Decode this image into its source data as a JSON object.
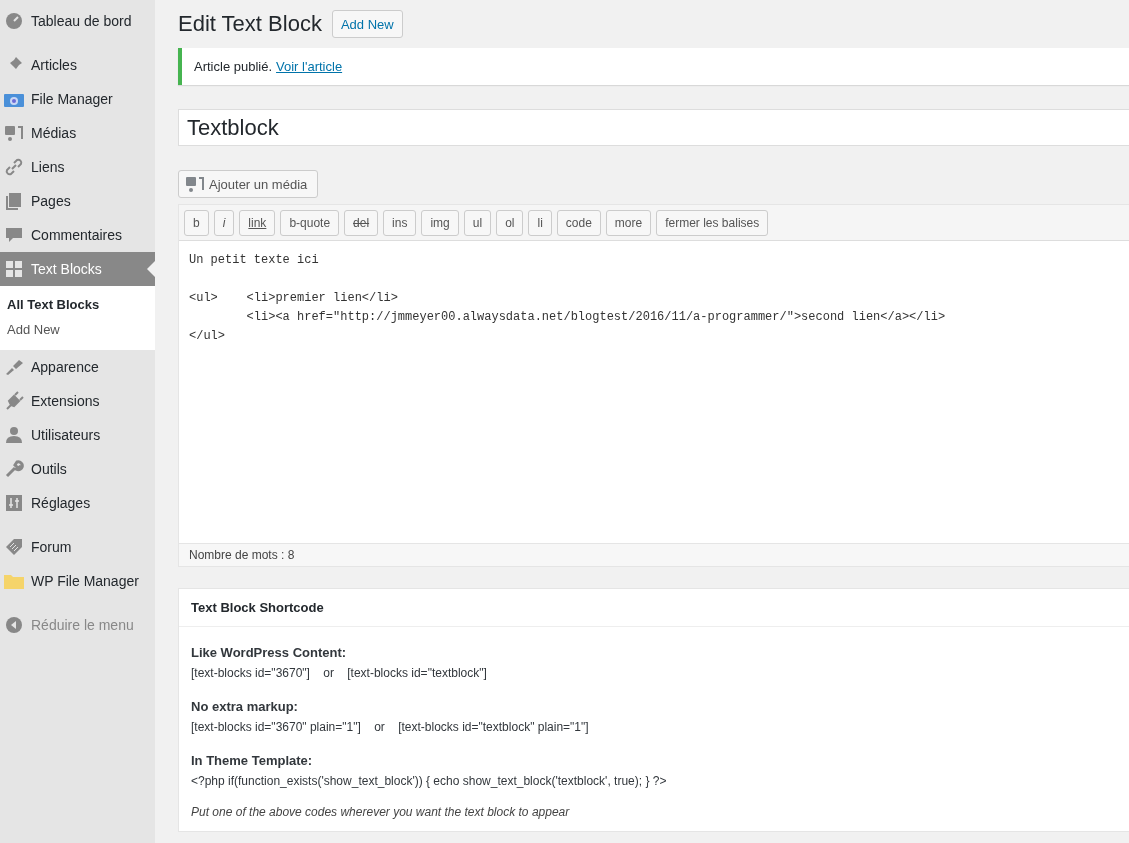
{
  "sidebar": {
    "groups": [
      [
        {
          "label": "Tableau de bord",
          "selected": false
        }
      ],
      [
        {
          "label": "Articles",
          "selected": false
        },
        {
          "label": "File Manager",
          "selected": false
        },
        {
          "label": "Médias",
          "selected": false
        },
        {
          "label": "Liens",
          "selected": false
        },
        {
          "label": "Pages",
          "selected": false
        },
        {
          "label": "Commentaires",
          "selected": false
        },
        {
          "label": "Text Blocks",
          "selected": true,
          "children": [
            {
              "label": "All Text Blocks",
              "selected": true
            },
            {
              "label": "Add New",
              "selected": false
            }
          ]
        },
        {
          "label": "Apparence",
          "selected": false
        },
        {
          "label": "Extensions",
          "selected": false
        },
        {
          "label": "Utilisateurs",
          "selected": false
        },
        {
          "label": "Outils",
          "selected": false
        },
        {
          "label": "Réglages",
          "selected": false
        }
      ],
      [
        {
          "label": "Forum",
          "selected": false
        },
        {
          "label": "WP File Manager",
          "selected": false
        }
      ]
    ],
    "collapse_label": "Réduire le menu"
  },
  "page": {
    "title": "Edit Text Block",
    "add_new": "Add New"
  },
  "notice": {
    "text": "Article publié.",
    "link": "Voir l'article"
  },
  "post_title": {
    "value": "Textblock"
  },
  "editor": {
    "media_button": "Ajouter un média",
    "quicktags": [
      {
        "label": "b",
        "kind": "bold"
      },
      {
        "label": "i",
        "kind": "italic"
      },
      {
        "label": "link",
        "kind": "link"
      },
      {
        "label": "b-quote",
        "kind": "plain"
      },
      {
        "label": "del",
        "kind": "strike"
      },
      {
        "label": "ins",
        "kind": "plain"
      },
      {
        "label": "img",
        "kind": "plain"
      },
      {
        "label": "ul",
        "kind": "plain"
      },
      {
        "label": "ol",
        "kind": "plain"
      },
      {
        "label": "li",
        "kind": "plain"
      },
      {
        "label": "code",
        "kind": "plain"
      },
      {
        "label": "more",
        "kind": "plain"
      },
      {
        "label": "fermer les balises",
        "kind": "plain"
      }
    ],
    "paragraphs": [
      [
        "Un petit texte ici"
      ],
      [
        "<ul>    <li>premier lien</li>",
        "        <li><a href=\"http://jmmeyer00.alwaysdata.net/blogtest/2016/11/a-programmer/\">second lien</a></li>",
        "</ul>"
      ]
    ],
    "word_count": "Nombre de mots : 8"
  },
  "shortcode_box": {
    "title": "Text Block Shortcode",
    "sections": [
      {
        "heading": "Like WordPress Content:",
        "code": "[text-blocks id=\"3670\"]    or    [text-blocks id=\"textblock\"]"
      },
      {
        "heading": "No extra markup:",
        "code": "[text-blocks id=\"3670\" plain=\"1\"]    or    [text-blocks id=\"textblock\" plain=\"1\"]"
      },
      {
        "heading": "In Theme Template:",
        "code": "<?php if(function_exists('show_text_block')) { echo show_text_block('textblock', true); } ?>"
      }
    ],
    "note": "Put one of the above codes wherever you want the text block to appear"
  }
}
